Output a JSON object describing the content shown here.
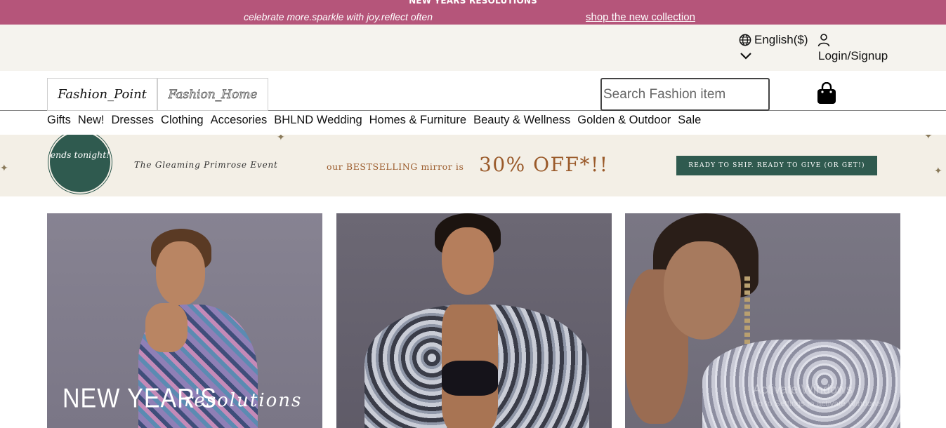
{
  "announcement": {
    "headline": "NEW YEARS RESOLUTIONS",
    "tagline": "celebrate more.sparkle with joy.reflect often",
    "link": "shop the new collection",
    "background": "#b5557a"
  },
  "utility": {
    "language": "English($)",
    "login": "Login/Signup"
  },
  "header": {
    "brand_primary": "Fashion_Point",
    "brand_secondary": "Fashion_Home",
    "search_placeholder": "Search Fashion item"
  },
  "nav": {
    "items": [
      "Gifts",
      "New!",
      "Dresses",
      "Clothing",
      "Accesories",
      "BHLND Wedding",
      "Homes & Furniture",
      "Beauty & Wellness",
      "Golden & Outdoor",
      "Sale"
    ]
  },
  "promo": {
    "badge": "ends tonight!",
    "event": "The Gleaming Primrose Event",
    "mirror": "our BESTSELLING mirror is",
    "offer": "30% OFF*!!",
    "cta": "READY TO SHIP. READY TO GIVE (OR GET!)",
    "accent": "#2f5a4f"
  },
  "tiles": [
    {
      "overlay_title": "NEW YEAR'S",
      "overlay_script": "resolutions"
    },
    {},
    {}
  ],
  "watermark": {
    "line1": "Activate Windows",
    "line2": "Go to Settings to activate Windows."
  }
}
